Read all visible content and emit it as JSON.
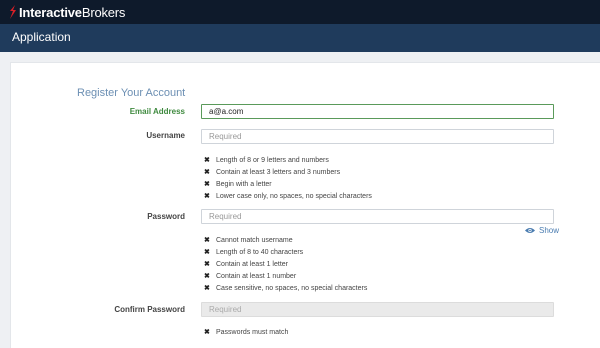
{
  "brand": {
    "prefix": "Interactive",
    "suffix": "Brokers"
  },
  "app": {
    "title": "Application"
  },
  "form": {
    "section_title": "Register Your Account",
    "email": {
      "label": "Email Address",
      "value": "a@a.com"
    },
    "username": {
      "label": "Username",
      "placeholder": "Required",
      "rules": [
        "Length of 8 or 9 letters and numbers",
        "Contain at least 3 letters and 3 numbers",
        "Begin with a letter",
        "Lower case only, no spaces, no special characters"
      ]
    },
    "password": {
      "label": "Password",
      "placeholder": "Required",
      "show_label": "Show",
      "rules": [
        "Cannot match username",
        "Length of 8 to 40 characters",
        "Contain at least 1 letter",
        "Contain at least 1 number",
        "Case sensitive, no spaces, no special characters"
      ]
    },
    "confirm": {
      "label": "Confirm Password",
      "placeholder": "Required",
      "rules": [
        "Passwords must match"
      ]
    }
  },
  "colors": {
    "topbar": "#0e1a2b",
    "appbar": "#1f3b5c",
    "brand_red": "#d81f26",
    "valid_green": "#3f8a3f"
  }
}
